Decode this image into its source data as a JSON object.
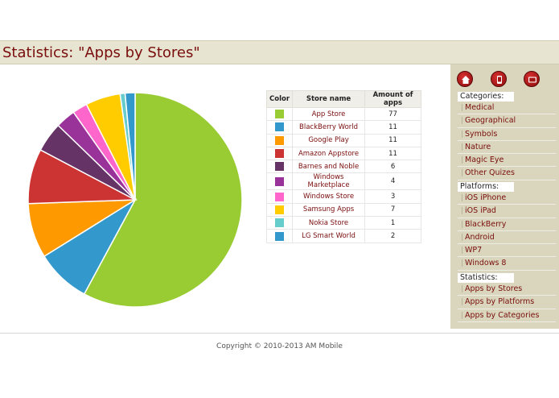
{
  "page": {
    "title": "Statistics: \"Apps by Stores\""
  },
  "table": {
    "headers": [
      "Color",
      "Store name",
      "Amount of apps"
    ],
    "rows": [
      {
        "name": "App Store",
        "amount": "77",
        "color": "#99cc33"
      },
      {
        "name": "BlackBerry World",
        "amount": "11",
        "color": "#3399cc"
      },
      {
        "name": "Google Play",
        "amount": "11",
        "color": "#ff9900"
      },
      {
        "name": "Amazon Appstore",
        "amount": "11",
        "color": "#cc3333"
      },
      {
        "name": "Barnes and Noble",
        "amount": "6",
        "color": "#663366"
      },
      {
        "name": "Windows Marketplace",
        "amount": "4",
        "color": "#993399"
      },
      {
        "name": "Windows Store",
        "amount": "3",
        "color": "#ff66cc"
      },
      {
        "name": "Samsung Apps",
        "amount": "7",
        "color": "#ffcc00"
      },
      {
        "name": "Nokia Store",
        "amount": "1",
        "color": "#66cccc"
      },
      {
        "name": "LG Smart World",
        "amount": "2",
        "color": "#3399cc"
      }
    ]
  },
  "chart_data": {
    "type": "pie",
    "categories": [
      "App Store",
      "BlackBerry World",
      "Google Play",
      "Amazon Appstore",
      "Barnes and Noble",
      "Windows Marketplace",
      "Windows Store",
      "Samsung Apps",
      "Nokia Store",
      "LG Smart World"
    ],
    "values": [
      77,
      11,
      11,
      11,
      6,
      4,
      3,
      7,
      1,
      2
    ],
    "colors": [
      "#99cc33",
      "#3399cc",
      "#ff9900",
      "#cc3333",
      "#663366",
      "#993399",
      "#ff66cc",
      "#ffcc00",
      "#66cccc",
      "#3399cc"
    ]
  },
  "sidebar": {
    "icons": [
      "home-icon",
      "phone-icon",
      "tablet-icon"
    ],
    "categories_title": "Categories:",
    "categories": [
      "Medical",
      "Geographical",
      "Symbols",
      "Nature",
      "Magic Eye",
      "Other Quizes"
    ],
    "platforms_title": "Platforms:",
    "platforms": [
      "iOS iPhone",
      "iOS iPad",
      "BlackBerry",
      "Android",
      "WP7",
      "Windows 8"
    ],
    "statistics_title": "Statistics:",
    "statistics": [
      "Apps by Stores",
      "Apps by Platforms",
      "Apps by Categories"
    ]
  },
  "footer": {
    "copyright": "Copyright © 2010-2013 AM Mobile"
  }
}
